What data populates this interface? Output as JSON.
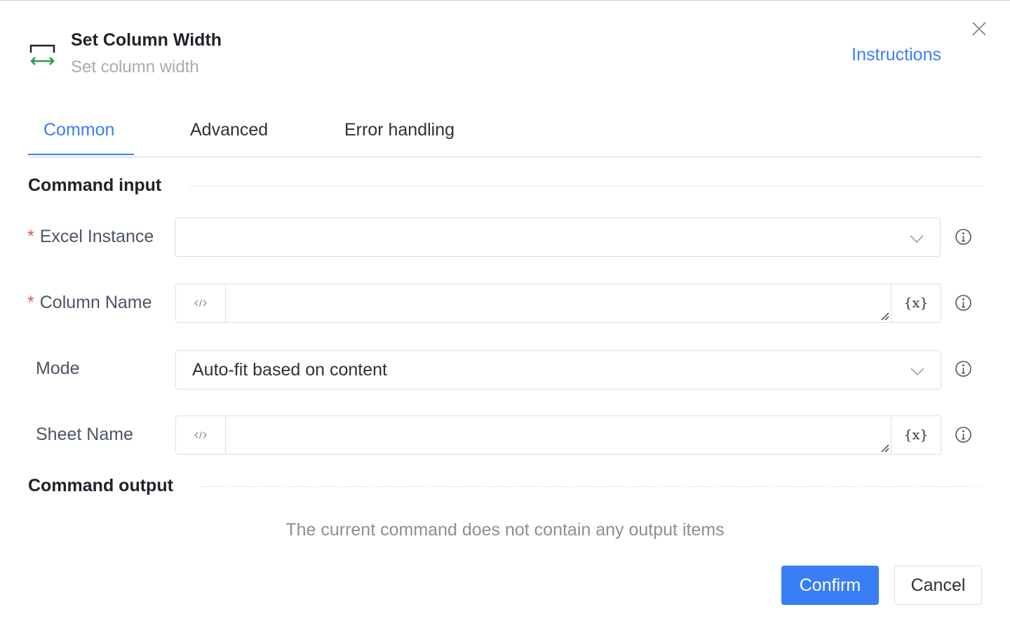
{
  "header": {
    "title": "Set Column Width",
    "subtitle": "Set column width",
    "instructions_link": "Instructions",
    "icon": "column-width-icon",
    "icon_arrow_color": "#2e9a48"
  },
  "tabs": [
    {
      "label": "Common",
      "active": true
    },
    {
      "label": "Advanced",
      "active": false
    },
    {
      "label": "Error handling",
      "active": false
    }
  ],
  "sections": {
    "input_title": "Command input",
    "output_title": "Command output",
    "no_output_text": "The current command does not contain any output items"
  },
  "fields": {
    "excel_instance": {
      "label": "Excel Instance",
      "required": true,
      "value": ""
    },
    "column_name": {
      "label": "Column Name",
      "required": true,
      "value": ""
    },
    "mode": {
      "label": "Mode",
      "required": false,
      "value": "Auto-fit based on content"
    },
    "sheet_name": {
      "label": "Sheet Name",
      "required": false,
      "value": ""
    }
  },
  "required_mark": "*",
  "variable_button_label": "{x}",
  "buttons": {
    "confirm": "Confirm",
    "cancel": "Cancel"
  },
  "colors": {
    "accent": "#3a7ef5",
    "required": "#f05050"
  }
}
